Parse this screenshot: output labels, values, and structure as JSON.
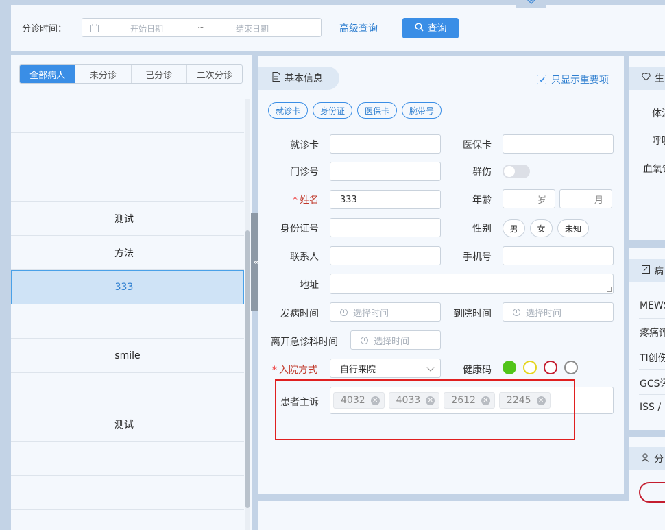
{
  "filter": {
    "label": "分诊时间：",
    "start_placeholder": "开始日期",
    "separator": "~",
    "end_placeholder": "结束日期",
    "advanced_label": "高级查询",
    "search_label": "查询"
  },
  "patient_list": {
    "tabs": [
      {
        "label": "全部病人",
        "active": true
      },
      {
        "label": "未分诊",
        "active": false
      },
      {
        "label": "已分诊",
        "active": false
      },
      {
        "label": "二次分诊",
        "active": false
      }
    ],
    "rows": [
      "",
      "",
      "",
      "测试",
      "方法",
      "333",
      "",
      "smile",
      "",
      "测试",
      "",
      "",
      ""
    ],
    "selected_index": 5
  },
  "basic_info": {
    "title": "基本信息",
    "only_important_label": "只显示重要项",
    "chips": [
      "就诊卡",
      "身份证",
      "医保卡",
      "腕带号"
    ],
    "labels": {
      "visit_card": "就诊卡",
      "insurance_card": "医保卡",
      "outpatient_no": "门诊号",
      "mass_injury": "群伤",
      "name": "姓名",
      "age": "年龄",
      "id_no": "身份证号",
      "gender": "性别",
      "contact": "联系人",
      "phone": "手机号",
      "address": "地址",
      "onset_time": "发病时间",
      "arrival_time": "到院时间",
      "leave_time": "离开急诊科时间",
      "admission_mode": "入院方式",
      "health_code": "健康码",
      "chief_complaint": "患者主诉"
    },
    "values": {
      "name": "333",
      "admission_mode": "自行来院"
    },
    "age_units": {
      "year": "岁",
      "month": "月"
    },
    "gender_options": [
      "男",
      "女",
      "未知"
    ],
    "time_placeholder": "选择时间",
    "health_code_colors": [
      "#52c41a",
      "#e5d51f",
      "#c41d2f",
      "#8c8c8c"
    ],
    "complaint_tags": [
      "4032",
      "4033",
      "2612",
      "2245"
    ],
    "required_mark": "*"
  },
  "right_panel": {
    "vitals_head": "生",
    "vitals_items": [
      "体温",
      "呼吸",
      "血氧饱"
    ],
    "score_head": "病",
    "score_items": [
      "MEWS",
      "疼痛评",
      "TI创伤",
      "GCS评",
      "ISS /"
    ],
    "triage_head": "分"
  }
}
